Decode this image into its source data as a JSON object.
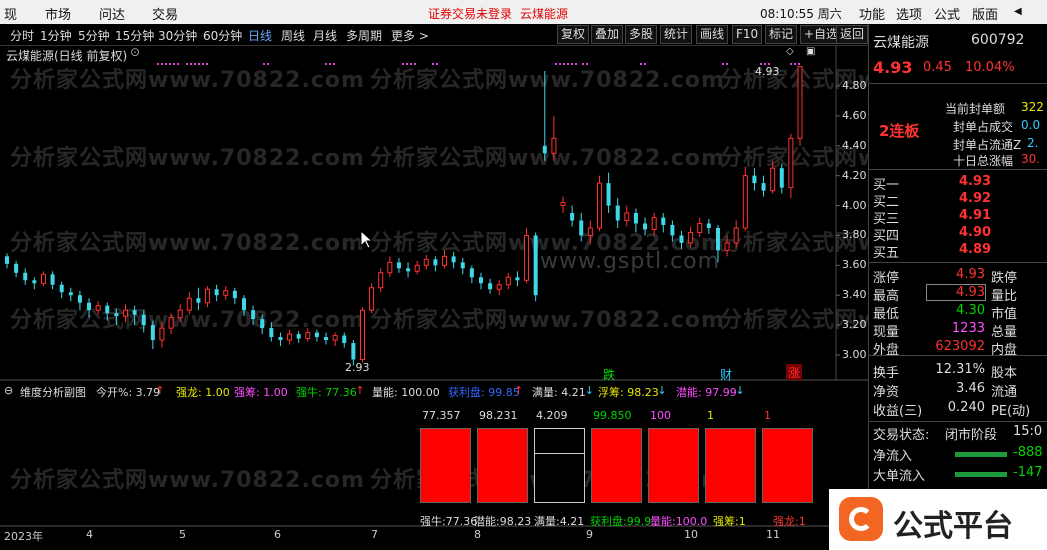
{
  "menu": {
    "items": [
      "现",
      "市场",
      "问达",
      "交易"
    ],
    "warning": "证券交易未登录",
    "stock_name": "云煤能源",
    "clock": "08:10:55 周六",
    "right_items": [
      "功能",
      "选项",
      "公式",
      "版面"
    ]
  },
  "periods": [
    "分时",
    "1分钟",
    "5分钟",
    "15分钟",
    "30分钟",
    "60分钟",
    "日线",
    "周线",
    "月线",
    "多周期",
    "更多 >"
  ],
  "active_period": "日线",
  "toolbar": [
    "复权",
    "叠加",
    "多股",
    "统计",
    "画线",
    "F10",
    "标记",
    "+自选",
    "返回"
  ],
  "chart_title": "云煤能源(日线 前复权)",
  "main_chart": {
    "y_ticks": [
      "4.80",
      "4.60",
      "4.40",
      "4.20",
      "4.00",
      "3.80",
      "3.60",
      "3.40",
      "3.20",
      "3.00"
    ],
    "x_ticks": [
      "2023年",
      "4",
      "5",
      "6",
      "7",
      "8",
      "9",
      "10",
      "11"
    ],
    "high_label": "4.93",
    "low_label": "2.93",
    "watermark": "分析家公式网www.70822.com",
    "center_watermark": "www.gsptl.com",
    "markers": [
      {
        "text": "跌",
        "color": "#00e000"
      },
      {
        "text": "财",
        "color": "#3cf"
      },
      {
        "text": "涨",
        "color": "#ff3232"
      }
    ],
    "candles": [
      {
        "o": 3.66,
        "c": 3.61,
        "h": 3.68,
        "l": 3.58
      },
      {
        "o": 3.61,
        "c": 3.55,
        "h": 3.63,
        "l": 3.52
      },
      {
        "o": 3.55,
        "c": 3.5,
        "h": 3.58,
        "l": 3.47
      },
      {
        "o": 3.5,
        "c": 3.48,
        "h": 3.52,
        "l": 3.44
      },
      {
        "o": 3.48,
        "c": 3.54,
        "h": 3.56,
        "l": 3.46
      },
      {
        "o": 3.54,
        "c": 3.47,
        "h": 3.56,
        "l": 3.44
      },
      {
        "o": 3.47,
        "c": 3.42,
        "h": 3.49,
        "l": 3.38
      },
      {
        "o": 3.42,
        "c": 3.4,
        "h": 3.45,
        "l": 3.36
      },
      {
        "o": 3.4,
        "c": 3.35,
        "h": 3.43,
        "l": 3.3
      },
      {
        "o": 3.35,
        "c": 3.3,
        "h": 3.38,
        "l": 3.25
      },
      {
        "o": 3.3,
        "c": 3.33,
        "h": 3.36,
        "l": 3.27
      },
      {
        "o": 3.33,
        "c": 3.28,
        "h": 3.35,
        "l": 3.23
      },
      {
        "o": 3.28,
        "c": 3.26,
        "h": 3.31,
        "l": 3.2
      },
      {
        "o": 3.26,
        "c": 3.3,
        "h": 3.34,
        "l": 3.22
      },
      {
        "o": 3.3,
        "c": 3.27,
        "h": 3.33,
        "l": 3.2
      },
      {
        "o": 3.27,
        "c": 3.2,
        "h": 3.3,
        "l": 3.15
      },
      {
        "o": 3.2,
        "c": 3.1,
        "h": 3.23,
        "l": 3.04
      },
      {
        "o": 3.1,
        "c": 3.18,
        "h": 3.22,
        "l": 3.05
      },
      {
        "o": 3.18,
        "c": 3.25,
        "h": 3.28,
        "l": 3.14
      },
      {
        "o": 3.25,
        "c": 3.3,
        "h": 3.34,
        "l": 3.22
      },
      {
        "o": 3.3,
        "c": 3.38,
        "h": 3.42,
        "l": 3.27
      },
      {
        "o": 3.38,
        "c": 3.35,
        "h": 3.45,
        "l": 3.3
      },
      {
        "o": 3.35,
        "c": 3.44,
        "h": 3.46,
        "l": 3.32
      },
      {
        "o": 3.44,
        "c": 3.4,
        "h": 3.47,
        "l": 3.36
      },
      {
        "o": 3.4,
        "c": 3.43,
        "h": 3.46,
        "l": 3.37
      },
      {
        "o": 3.43,
        "c": 3.38,
        "h": 3.45,
        "l": 3.34
      },
      {
        "o": 3.38,
        "c": 3.3,
        "h": 3.4,
        "l": 3.26
      },
      {
        "o": 3.3,
        "c": 3.24,
        "h": 3.33,
        "l": 3.2
      },
      {
        "o": 3.24,
        "c": 3.18,
        "h": 3.27,
        "l": 3.14
      },
      {
        "o": 3.18,
        "c": 3.12,
        "h": 3.22,
        "l": 3.09
      },
      {
        "o": 3.12,
        "c": 3.1,
        "h": 3.15,
        "l": 3.06
      },
      {
        "o": 3.1,
        "c": 3.14,
        "h": 3.17,
        "l": 3.07
      },
      {
        "o": 3.14,
        "c": 3.11,
        "h": 3.16,
        "l": 3.08
      },
      {
        "o": 3.11,
        "c": 3.15,
        "h": 3.18,
        "l": 3.09
      },
      {
        "o": 3.15,
        "c": 3.12,
        "h": 3.17,
        "l": 3.09
      },
      {
        "o": 3.12,
        "c": 3.1,
        "h": 3.15,
        "l": 3.07
      },
      {
        "o": 3.1,
        "c": 3.13,
        "h": 3.15,
        "l": 3.06
      },
      {
        "o": 3.13,
        "c": 3.08,
        "h": 3.15,
        "l": 3.05
      },
      {
        "o": 3.08,
        "c": 2.97,
        "h": 3.1,
        "l": 2.93
      },
      {
        "o": 2.97,
        "c": 3.3,
        "h": 3.32,
        "l": 2.95
      },
      {
        "o": 3.3,
        "c": 3.45,
        "h": 3.48,
        "l": 3.28
      },
      {
        "o": 3.45,
        "c": 3.55,
        "h": 3.58,
        "l": 3.42
      },
      {
        "o": 3.55,
        "c": 3.62,
        "h": 3.66,
        "l": 3.52
      },
      {
        "o": 3.62,
        "c": 3.58,
        "h": 3.65,
        "l": 3.55
      },
      {
        "o": 3.58,
        "c": 3.56,
        "h": 3.62,
        "l": 3.52
      },
      {
        "o": 3.56,
        "c": 3.6,
        "h": 3.63,
        "l": 3.54
      },
      {
        "o": 3.6,
        "c": 3.64,
        "h": 3.67,
        "l": 3.57
      },
      {
        "o": 3.64,
        "c": 3.6,
        "h": 3.66,
        "l": 3.56
      },
      {
        "o": 3.6,
        "c": 3.66,
        "h": 3.7,
        "l": 3.58
      },
      {
        "o": 3.66,
        "c": 3.62,
        "h": 3.69,
        "l": 3.58
      },
      {
        "o": 3.62,
        "c": 3.58,
        "h": 3.65,
        "l": 3.54
      },
      {
        "o": 3.58,
        "c": 3.52,
        "h": 3.6,
        "l": 3.48
      },
      {
        "o": 3.52,
        "c": 3.48,
        "h": 3.55,
        "l": 3.44
      },
      {
        "o": 3.48,
        "c": 3.44,
        "h": 3.51,
        "l": 3.41
      },
      {
        "o": 3.44,
        "c": 3.47,
        "h": 3.5,
        "l": 3.4
      },
      {
        "o": 3.47,
        "c": 3.52,
        "h": 3.55,
        "l": 3.44
      },
      {
        "o": 3.52,
        "c": 3.5,
        "h": 3.56,
        "l": 3.46
      },
      {
        "o": 3.5,
        "c": 3.8,
        "h": 3.85,
        "l": 3.48
      },
      {
        "o": 3.8,
        "c": 3.4,
        "h": 3.82,
        "l": 3.36
      },
      {
        "o": 4.4,
        "c": 4.35,
        "h": 4.9,
        "l": 4.3
      },
      {
        "o": 4.35,
        "c": 4.45,
        "h": 4.6,
        "l": 4.3
      },
      {
        "o": 4.0,
        "c": 4.02,
        "h": 4.06,
        "l": 3.95
      },
      {
        "o": 3.95,
        "c": 3.9,
        "h": 4.0,
        "l": 3.86
      },
      {
        "o": 3.9,
        "c": 3.8,
        "h": 3.95,
        "l": 3.76
      },
      {
        "o": 3.8,
        "c": 3.85,
        "h": 3.9,
        "l": 3.74
      },
      {
        "o": 3.85,
        "c": 4.15,
        "h": 4.2,
        "l": 3.83
      },
      {
        "o": 4.15,
        "c": 4.0,
        "h": 4.22,
        "l": 3.95
      },
      {
        "o": 4.0,
        "c": 3.9,
        "h": 4.05,
        "l": 3.85
      },
      {
        "o": 3.9,
        "c": 3.95,
        "h": 4.0,
        "l": 3.86
      },
      {
        "o": 3.95,
        "c": 3.88,
        "h": 3.98,
        "l": 3.82
      },
      {
        "o": 3.88,
        "c": 3.84,
        "h": 3.92,
        "l": 3.8
      },
      {
        "o": 3.84,
        "c": 3.92,
        "h": 3.95,
        "l": 3.8
      },
      {
        "o": 3.92,
        "c": 3.87,
        "h": 3.95,
        "l": 3.82
      },
      {
        "o": 3.87,
        "c": 3.8,
        "h": 3.9,
        "l": 3.76
      },
      {
        "o": 3.8,
        "c": 3.75,
        "h": 3.83,
        "l": 3.71
      },
      {
        "o": 3.75,
        "c": 3.82,
        "h": 3.86,
        "l": 3.72
      },
      {
        "o": 3.82,
        "c": 3.88,
        "h": 3.92,
        "l": 3.79
      },
      {
        "o": 3.88,
        "c": 3.85,
        "h": 3.91,
        "l": 3.81
      },
      {
        "o": 3.85,
        "c": 3.7,
        "h": 3.87,
        "l": 3.62
      },
      {
        "o": 3.7,
        "c": 3.75,
        "h": 3.8,
        "l": 3.66
      },
      {
        "o": 3.75,
        "c": 3.85,
        "h": 3.9,
        "l": 3.72
      },
      {
        "o": 3.85,
        "c": 4.2,
        "h": 4.26,
        "l": 3.83
      },
      {
        "o": 4.2,
        "c": 4.15,
        "h": 4.25,
        "l": 4.1
      },
      {
        "o": 4.15,
        "c": 4.1,
        "h": 4.2,
        "l": 4.06
      },
      {
        "o": 4.1,
        "c": 4.25,
        "h": 4.3,
        "l": 4.08
      },
      {
        "o": 4.25,
        "c": 4.12,
        "h": 4.28,
        "l": 4.08
      },
      {
        "o": 4.12,
        "c": 4.45,
        "h": 4.48,
        "l": 4.05
      },
      {
        "o": 4.45,
        "c": 4.93,
        "h": 4.93,
        "l": 4.4
      }
    ]
  },
  "indicator": {
    "title": "维度分析副图",
    "items": [
      {
        "label": "今开%: 3.79",
        "color": "#ddd",
        "arrow": "↑",
        "arrow_color": "#ff3232"
      },
      {
        "label": "强龙: 1.00",
        "color": "#e8e800",
        "arrow": "",
        "arrow_color": "#ff3232"
      },
      {
        "label": "强筹: 1.00",
        "color": "#ff4dff",
        "arrow": "",
        "arrow_color": "#ff3232"
      },
      {
        "label": "强牛: 77.36",
        "color": "#00d200",
        "arrow": "↑",
        "arrow_color": "#ff3232"
      },
      {
        "label": "量能: 100.00",
        "color": "#ddd",
        "arrow": "",
        "arrow_color": "#ff3232"
      },
      {
        "label": "获利盘: 99.85",
        "color": "#3366ff",
        "arrow": "↑",
        "arrow_color": "#ff3232"
      },
      {
        "label": "满量: 4.21",
        "color": "#ddd",
        "arrow": "↓",
        "arrow_color": "#3cf"
      },
      {
        "label": "浮筹: 98.23",
        "color": "#e8e800",
        "arrow": "↓",
        "arrow_color": "#3cf"
      },
      {
        "label": "潜能: 97.99",
        "color": "#ff4dff",
        "arrow": "↓",
        "arrow_color": "#3cf"
      }
    ],
    "box_values": [
      {
        "value": "77.357",
        "color": "#ddd",
        "filled": true
      },
      {
        "value": "98.231",
        "color": "#ddd",
        "filled": true
      },
      {
        "value": "4.209",
        "color": "#ddd",
        "filled": false
      },
      {
        "value": "99.850",
        "color": "#00d200",
        "filled": true
      },
      {
        "value": "100",
        "color": "#ff4dff",
        "filled": true
      },
      {
        "value": "1",
        "color": "#e8e800",
        "filled": true
      },
      {
        "value": "1",
        "color": "#ff3232",
        "filled": true
      }
    ],
    "footer": [
      {
        "text": "强牛:77.36",
        "color": "#ddd"
      },
      {
        "text": "潜能:98.23",
        "color": "#ddd"
      },
      {
        "text": "满量:4.21",
        "color": "#ddd"
      },
      {
        "text": "获利盘:99.9",
        "color": "#00d200"
      },
      {
        "text": "量能:100.0",
        "color": "#ff4dff"
      },
      {
        "text": "强筹:1",
        "color": "#e8e800"
      },
      {
        "text": "强龙:1",
        "color": "#ff3232"
      }
    ]
  },
  "quote": {
    "name": "云煤能源",
    "code": "600792",
    "price": "4.93",
    "change": "0.45",
    "pct": "10.04%",
    "limit_label": "2连板",
    "seal_labels": [
      "当前封单额",
      "封单占成交",
      "封单占流通Z",
      "十日总涨幅"
    ],
    "seal_values": [
      "322",
      "0.0",
      "2.",
      "30."
    ],
    "bids": [
      {
        "label": "买一",
        "price": "4.93"
      },
      {
        "label": "买二",
        "price": "4.92"
      },
      {
        "label": "买三",
        "price": "4.91"
      },
      {
        "label": "买四",
        "price": "4.90"
      },
      {
        "label": "买五",
        "price": "4.89"
      }
    ],
    "stats_left": [
      {
        "label": "涨停",
        "value": "4.93",
        "color": "#ff3232",
        "right": "跌停"
      },
      {
        "label": "最高",
        "value": "4.93",
        "color": "#ff3232",
        "right": "量比"
      },
      {
        "label": "最低",
        "value": "4.30",
        "color": "#00d200",
        "right": "市值"
      },
      {
        "label": "现量",
        "value": "1233",
        "color": "#ff4dff",
        "right": "总量"
      },
      {
        "label": "外盘",
        "value": "623092",
        "color": "#ff3232",
        "right": "内盘"
      }
    ],
    "stats2": [
      {
        "label": "换手",
        "value": "12.31%",
        "right": "股本"
      },
      {
        "label": "净资",
        "value": "3.46",
        "right": "流通"
      },
      {
        "label": "收益(三)",
        "value": "0.240",
        "right": "PE(动)"
      }
    ],
    "trade_status_label": "交易状态:",
    "trade_status_value": "闭市阶段",
    "trade_time": "15:0",
    "net_inflow_label": "净流入",
    "net_inflow_value": "-888",
    "big_inflow_label": "大单流入",
    "big_inflow_value": "-147"
  },
  "logo_text": "公式平台",
  "colors": {
    "up": "#ff3232",
    "down": "#00d200",
    "candle_down": "#40d8e8",
    "accent_blue": "#6aa8ff"
  }
}
